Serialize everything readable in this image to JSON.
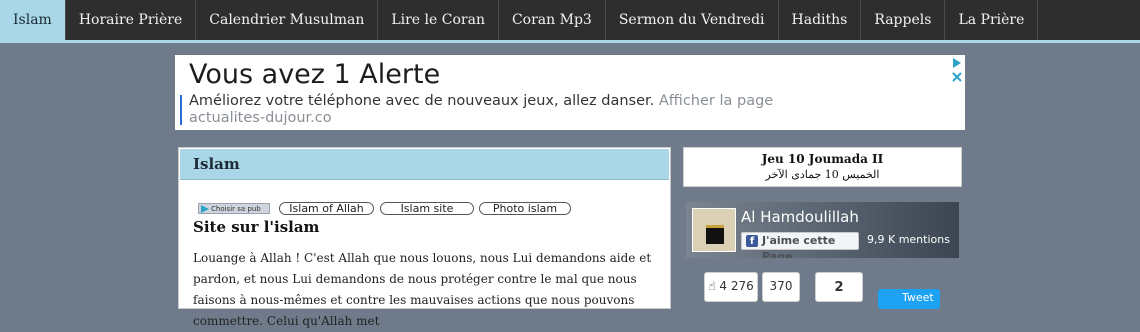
{
  "nav": {
    "items": [
      {
        "label": "Islam",
        "active": true
      },
      {
        "label": "Horaire Prière",
        "active": false
      },
      {
        "label": "Calendrier Musulman",
        "active": false
      },
      {
        "label": "Lire le Coran",
        "active": false
      },
      {
        "label": "Coran Mp3",
        "active": false
      },
      {
        "label": "Sermon du Vendredi",
        "active": false
      },
      {
        "label": "Hadiths",
        "active": false
      },
      {
        "label": "Rappels",
        "active": false
      },
      {
        "label": "La Prière",
        "active": false
      }
    ]
  },
  "ad": {
    "title": "Vous avez 1 Alerte",
    "body": "Améliorez votre téléphone avec de nouveaux jeux, allez danser.",
    "link": "Afficher la page actualites-dujour.co"
  },
  "main": {
    "header": "Islam",
    "ad_chooser": "Choisir sa pub",
    "tags": [
      "Islam of Allah",
      "Islam site",
      "Photo islam"
    ],
    "heading": "Site sur l'islam",
    "paragraph": "Louange à Allah ! C'est Allah que nous louons, nous Lui demandons aide et pardon, et nous Lui demandons de nous protéger contre le mal que nous faisons à nous-mêmes et contre les mauvaises actions que nous pouvons commettre. Celui qu'Allah met"
  },
  "date": {
    "french": "Jeu 10 Joumada II",
    "arabic": "الخميس 10 جمادى الآخر"
  },
  "facebook": {
    "page_name": "Al Hamdoulillah",
    "like_label": "J'aime cette Page",
    "mentions": "9,9 K mentions"
  },
  "share": {
    "likes": "4 276",
    "count": "370",
    "number": "2",
    "tweet": "Tweet"
  },
  "colors": {
    "nav_bg": "#2e2e2e",
    "accent": "#a9d7e8",
    "page_bg": "#6f7b8b",
    "ad_blue": "#2b6bd6",
    "twitter": "#1da1f2"
  }
}
